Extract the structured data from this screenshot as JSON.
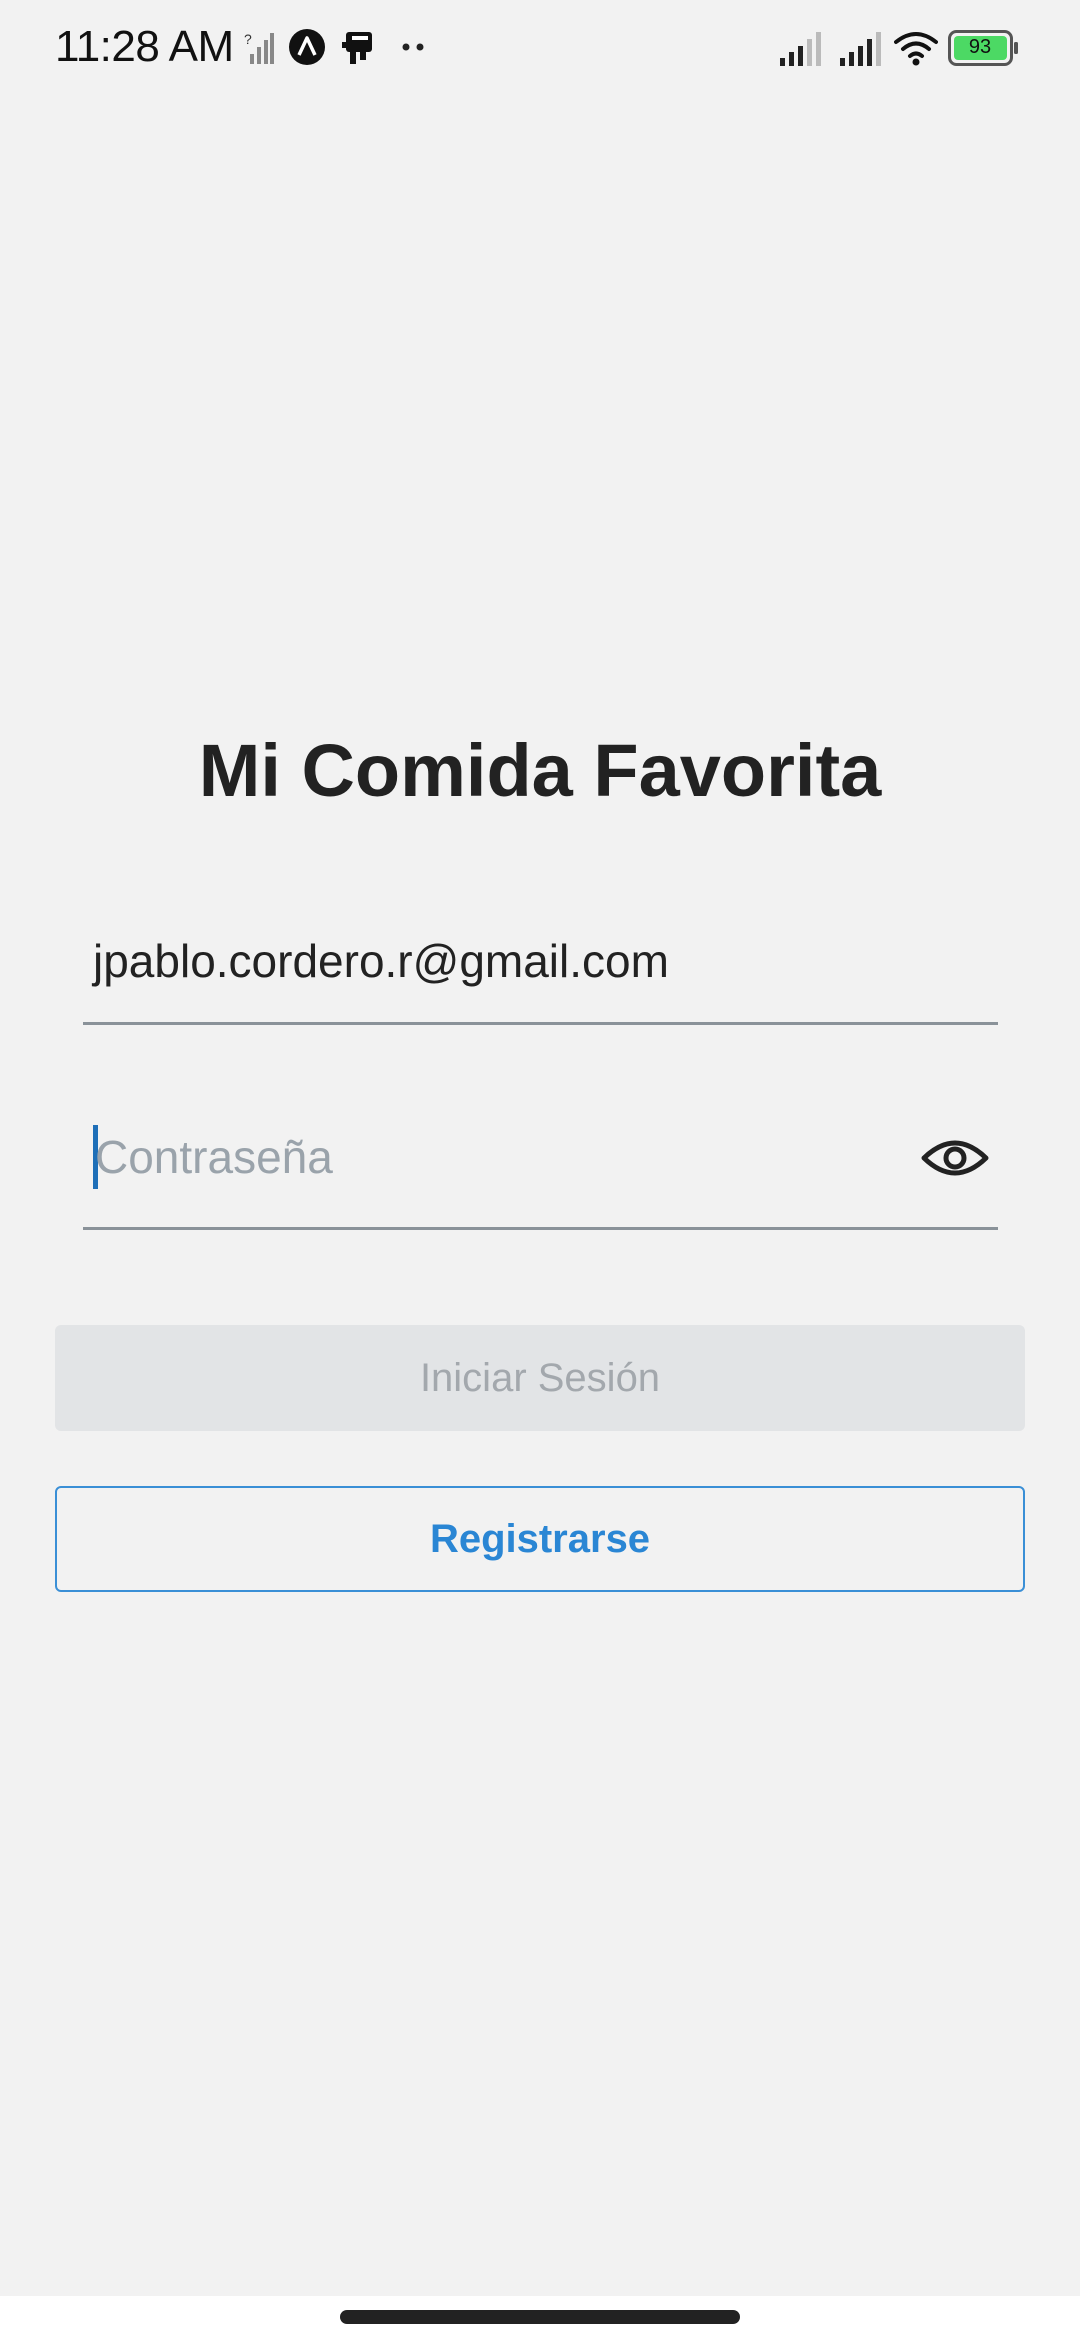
{
  "status_bar": {
    "time": "11:28 AM",
    "battery_level": "93",
    "icons": [
      "no-sim-signal-icon",
      "app-notification-icon",
      "printer-icon",
      "more-dots-icon",
      "signal-icon",
      "signal-icon",
      "wifi-icon",
      "battery-icon"
    ]
  },
  "login": {
    "title": "Mi Comida Favorita",
    "email_value": "jpablo.cordero.r@gmail.com",
    "password_placeholder": "Contraseña",
    "login_label": "Iniciar Sesión",
    "register_label": "Registrarse"
  },
  "colors": {
    "background": "#f2f2f2",
    "accent": "#2a86d4",
    "disabled_button": "#e2e4e6",
    "battery": "#4cd964"
  }
}
